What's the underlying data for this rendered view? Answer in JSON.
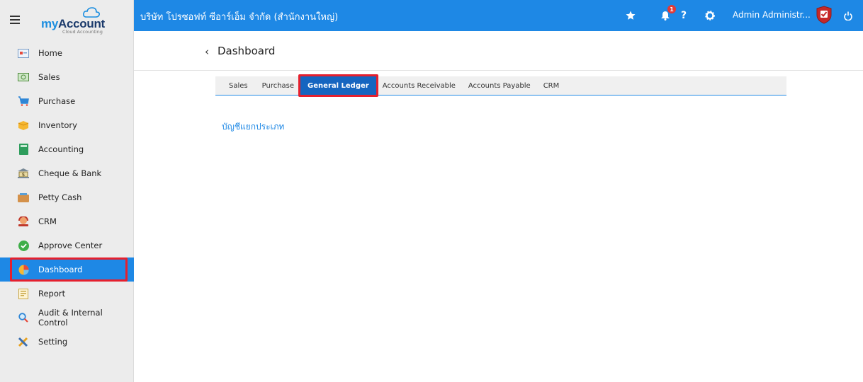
{
  "logo": {
    "brand_prefix": "my",
    "brand_main": "Account",
    "tagline": "Cloud Accounting"
  },
  "sidebar": {
    "items": [
      {
        "label": "Home",
        "icon": "home-icon"
      },
      {
        "label": "Sales",
        "icon": "sales-icon"
      },
      {
        "label": "Purchase",
        "icon": "cart-icon"
      },
      {
        "label": "Inventory",
        "icon": "box-icon"
      },
      {
        "label": "Accounting",
        "icon": "book-icon"
      },
      {
        "label": "Cheque & Bank",
        "icon": "bank-icon"
      },
      {
        "label": "Petty Cash",
        "icon": "wallet-icon"
      },
      {
        "label": "CRM",
        "icon": "crm-icon"
      },
      {
        "label": "Approve Center",
        "icon": "check-circle-icon"
      },
      {
        "label": "Dashboard",
        "icon": "pie-chart-icon",
        "active": true
      },
      {
        "label": "Report",
        "icon": "report-icon"
      },
      {
        "label": "Audit & Internal Control",
        "icon": "magnifier-icon"
      },
      {
        "label": "Setting",
        "icon": "tools-icon"
      }
    ]
  },
  "topbar": {
    "company": "บริษัท โปรซอฟท์ ซีอาร์เอ็ม จำกัด (สำนักงานใหญ่)",
    "notification_count": "1",
    "help": "?",
    "user": "Admin Administr..."
  },
  "page": {
    "back": "‹",
    "title": "Dashboard"
  },
  "tabs": [
    {
      "label": "Sales"
    },
    {
      "label": "Purchase"
    },
    {
      "label": "General Ledger",
      "active": true
    },
    {
      "label": "Accounts Receivable"
    },
    {
      "label": "Accounts Payable"
    },
    {
      "label": "CRM"
    }
  ],
  "content": {
    "link": "บัญชีแยกประเภท"
  },
  "colors": {
    "primary": "#1e88e5",
    "active_tab": "#1565c0",
    "highlight": "#e5202e",
    "sidebar_bg": "#ececec"
  }
}
